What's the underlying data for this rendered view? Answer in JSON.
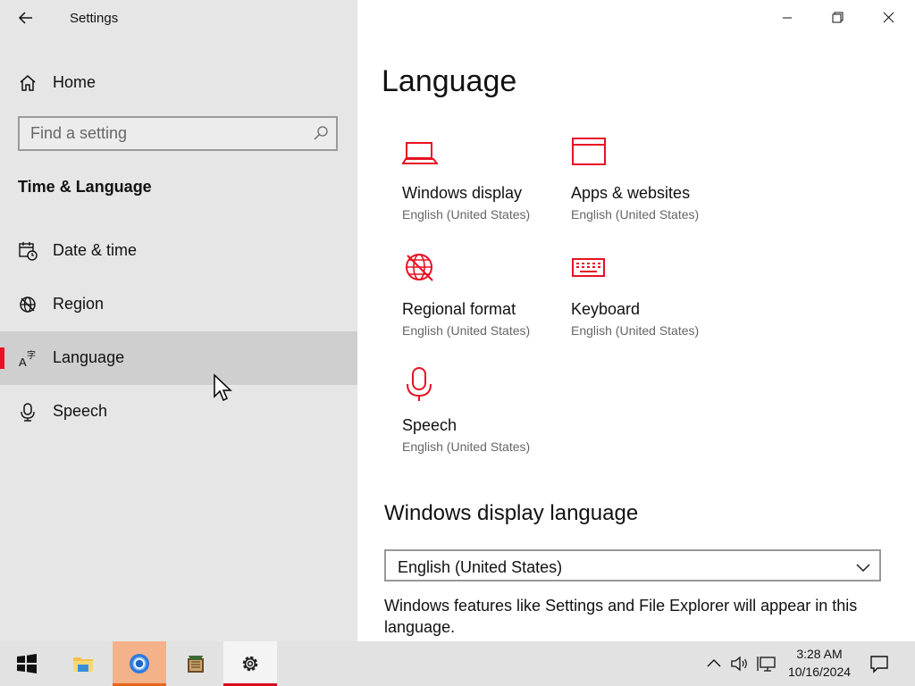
{
  "window": {
    "title": "Settings",
    "controls": [
      "minimize",
      "restore",
      "close"
    ]
  },
  "sidebar": {
    "home_label": "Home",
    "search_placeholder": "Find a setting",
    "section_title": "Time & Language",
    "items": [
      {
        "label": "Date & time",
        "icon": "calendar-clock-icon",
        "active": false
      },
      {
        "label": "Region",
        "icon": "globe-icon",
        "active": false
      },
      {
        "label": "Language",
        "icon": "language-icon",
        "active": true
      },
      {
        "label": "Speech",
        "icon": "microphone-icon",
        "active": false
      }
    ]
  },
  "main": {
    "title": "Language",
    "tiles": [
      {
        "title": "Windows display",
        "subtitle": "English (United States)",
        "icon": "laptop-icon"
      },
      {
        "title": "Apps & websites",
        "subtitle": "English (United States)",
        "icon": "window-icon"
      },
      {
        "title": "Regional format",
        "subtitle": "English (United States)",
        "icon": "regional-format-icon"
      },
      {
        "title": "Keyboard",
        "subtitle": "English (United States)",
        "icon": "keyboard-icon"
      },
      {
        "title": "Speech",
        "subtitle": "English (United States)",
        "icon": "microphone-icon"
      }
    ],
    "display_language_heading": "Windows display language",
    "display_language_value": "English (United States)",
    "display_language_desc": "Windows features like Settings and File Explorer will appear in this language."
  },
  "taskbar": {
    "apps": [
      "start-icon",
      "file-explorer-icon",
      "chrome-icon",
      "archive-app-icon",
      "settings-gear-icon"
    ],
    "time": "3:28 AM",
    "date": "10/16/2024"
  },
  "colors": {
    "accent": "#e81123",
    "sidebar_bg": "#e6e6e6",
    "active_item_bg": "#cfcfcf"
  }
}
